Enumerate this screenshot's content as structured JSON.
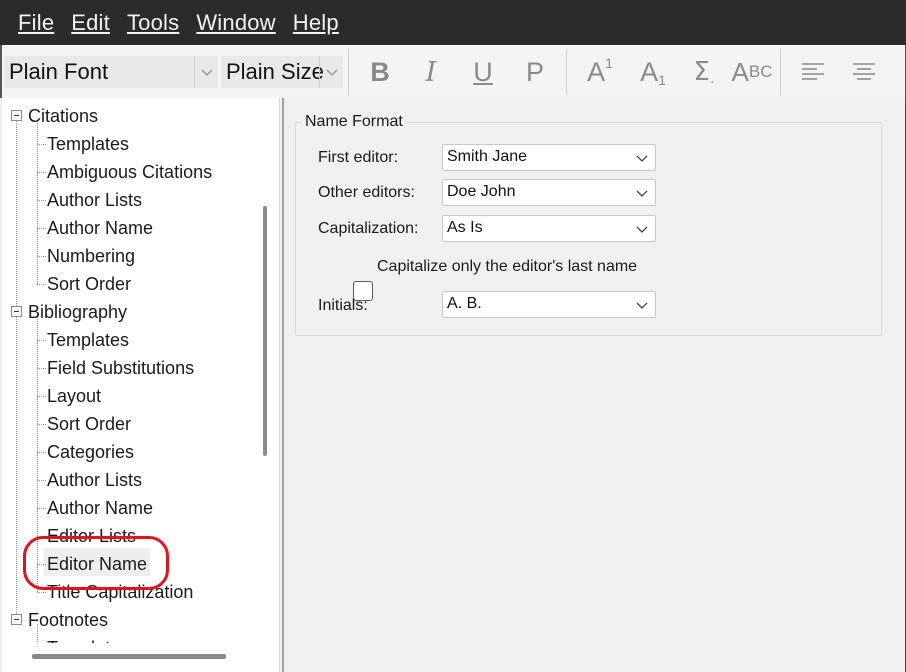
{
  "menu": [
    "File",
    "Edit",
    "Tools",
    "Window",
    "Help"
  ],
  "toolbar": {
    "font_value": "Plain Font",
    "size_value": "Plain Size",
    "bold": "B",
    "italic": "I",
    "underline": "U",
    "plain": "P",
    "superscript_base": "A",
    "superscript_mark": "1",
    "subscript_base": "A",
    "subscript_mark": "1",
    "symbol": "Σ",
    "smallcaps_big": "A",
    "smallcaps_small": "BC"
  },
  "tree": {
    "groups": [
      {
        "label": "Citations",
        "items": [
          "Templates",
          "Ambiguous Citations",
          "Author Lists",
          "Author Name",
          "Numbering",
          "Sort Order"
        ]
      },
      {
        "label": "Bibliography",
        "items": [
          "Templates",
          "Field Substitutions",
          "Layout",
          "Sort Order",
          "Categories",
          "Author Lists",
          "Author Name",
          "Editor Lists",
          "Editor Name",
          "Title Capitalization"
        ]
      },
      {
        "label": "Footnotes",
        "items": [
          "Templates"
        ]
      }
    ],
    "selected": "Editor Name"
  },
  "name_format": {
    "title": "Name Format",
    "first_editor_label": "First editor:",
    "first_editor_value": "Smith Jane",
    "other_editors_label": "Other editors:",
    "other_editors_value": "Doe John",
    "capitalization_label": "Capitalization:",
    "capitalization_value": "As Is",
    "capitalize_checkbox_label": "Capitalize only the editor's last name",
    "capitalize_checked": false,
    "initials_label": "Initials:",
    "initials_value": "A. B."
  },
  "colors": {
    "menubar_bg": "#2b2b2b",
    "highlight_ring": "#e0141e"
  }
}
